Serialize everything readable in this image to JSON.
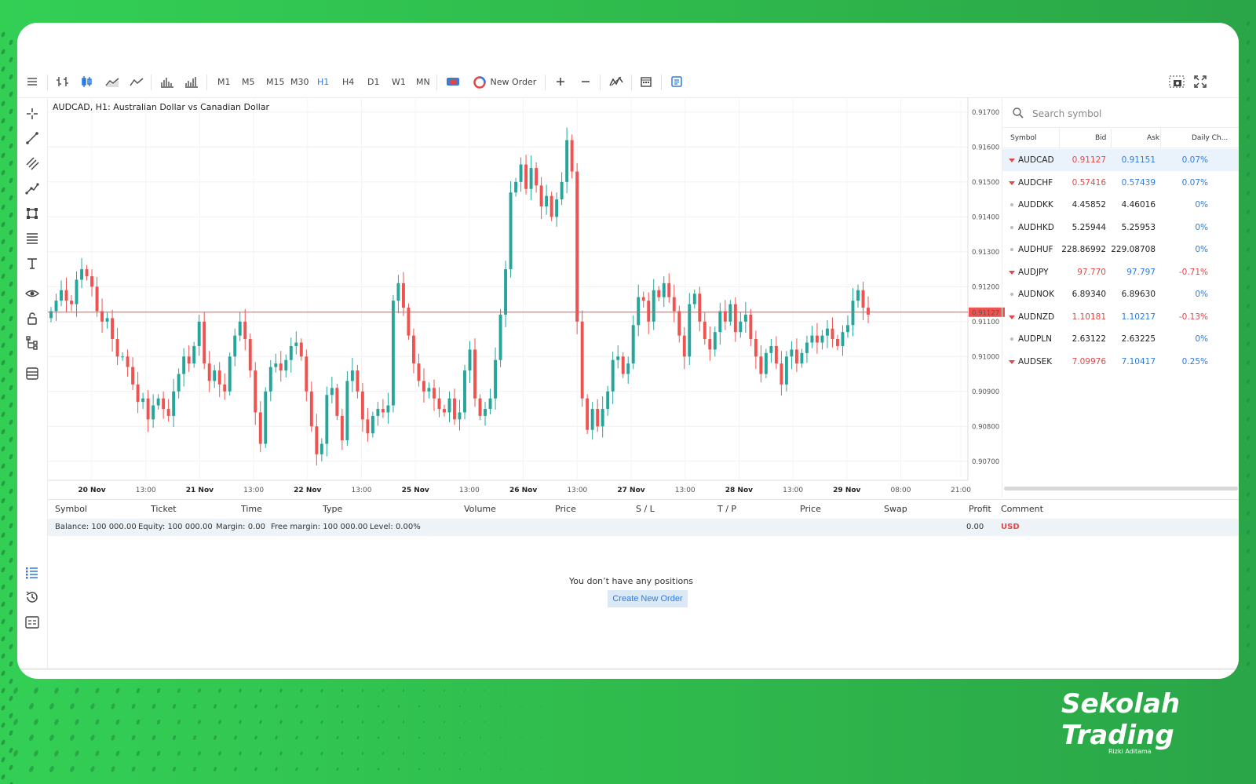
{
  "colors": {
    "bull": "#26a69a",
    "bear": "#ef5350",
    "accent": "#2e7be0",
    "frame": "#33cf55"
  },
  "toolbar": {
    "timeframes": [
      "M1",
      "M5",
      "M15",
      "M30",
      "H1",
      "H4",
      "D1",
      "W1",
      "MN"
    ],
    "active_timeframe": "H1",
    "new_order_label": "New Order",
    "icons": [
      "menu-icon",
      "bar-chart-icon",
      "candlestick-icon",
      "line-chart-icon",
      "line-icon",
      "volume-icon",
      "tick-volume-icon",
      "one-click-trading-icon",
      "zoom-in-icon",
      "zoom-out-icon",
      "indicators-icon",
      "calendar-icon",
      "depth-of-market-icon",
      "screenshot-icon",
      "fullscreen-icon"
    ]
  },
  "chart": {
    "title": "AUDCAD, H1: Australian Dollar vs Canadian Dollar",
    "current_price": "0.91127",
    "price_ticks": [
      "0.91700",
      "0.91600",
      "0.91500",
      "0.91400",
      "0.91300",
      "0.91200",
      "0.91100",
      "0.91000",
      "0.90900",
      "0.90800",
      "0.90700"
    ],
    "time_ticks": [
      {
        "label": "20 Nov",
        "bold": true
      },
      {
        "label": "13:00",
        "bold": false
      },
      {
        "label": "21 Nov",
        "bold": true
      },
      {
        "label": "13:00",
        "bold": false
      },
      {
        "label": "22 Nov",
        "bold": true
      },
      {
        "label": "13:00",
        "bold": false
      },
      {
        "label": "25 Nov",
        "bold": true
      },
      {
        "label": "13:00",
        "bold": false
      },
      {
        "label": "26 Nov",
        "bold": true
      },
      {
        "label": "13:00",
        "bold": false
      },
      {
        "label": "27 Nov",
        "bold": true
      },
      {
        "label": "13:00",
        "bold": false
      },
      {
        "label": "28 Nov",
        "bold": true
      },
      {
        "label": "13:00",
        "bold": false
      },
      {
        "label": "29 Nov",
        "bold": true
      },
      {
        "label": "08:00",
        "bold": false
      },
      {
        "label": "21:00",
        "bold": false
      }
    ]
  },
  "chart_data": {
    "type": "candlestick",
    "title": "AUDCAD, H1: Australian Dollar vs Canadian Dollar",
    "ylim": [
      0.9065,
      0.9172
    ],
    "current_price": 0.91127,
    "x": [
      "20 Nov",
      "13:00",
      "21 Nov",
      "13:00",
      "22 Nov",
      "13:00",
      "25 Nov",
      "13:00",
      "26 Nov",
      "13:00",
      "27 Nov",
      "13:00",
      "28 Nov",
      "13:00",
      "29 Nov",
      "08:00",
      "21:00"
    ],
    "closes": [
      0.9113,
      0.9116,
      0.9119,
      0.9116,
      0.9115,
      0.9122,
      0.9125,
      0.9123,
      0.912,
      0.9113,
      0.911,
      0.9111,
      0.9105,
      0.91,
      0.91,
      0.9097,
      0.9092,
      0.9087,
      0.9088,
      0.9082,
      0.9086,
      0.9088,
      0.9085,
      0.9083,
      0.909,
      0.9095,
      0.91,
      0.9098,
      0.9103,
      0.911,
      0.9098,
      0.9093,
      0.9096,
      0.9092,
      0.909,
      0.91,
      0.9106,
      0.911,
      0.9105,
      0.9096,
      0.9084,
      0.9075,
      0.909,
      0.9097,
      0.9098,
      0.9096,
      0.9099,
      0.9103,
      0.9104,
      0.91,
      0.909,
      0.908,
      0.9072,
      0.9075,
      0.9089,
      0.9091,
      0.9083,
      0.9076,
      0.9093,
      0.9096,
      0.909,
      0.9082,
      0.9078,
      0.9083,
      0.9085,
      0.9084,
      0.9086,
      0.9116,
      0.9121,
      0.9114,
      0.9106,
      0.9098,
      0.9093,
      0.909,
      0.9091,
      0.9088,
      0.9085,
      0.9084,
      0.9088,
      0.9082,
      0.9084,
      0.9096,
      0.9102,
      0.9088,
      0.9083,
      0.9085,
      0.9088,
      0.9099,
      0.9112,
      0.9125,
      0.9147,
      0.915,
      0.9155,
      0.9148,
      0.9154,
      0.9149,
      0.9143,
      0.9146,
      0.914,
      0.9145,
      0.915,
      0.9162,
      0.9153,
      0.911,
      0.9088,
      0.9079,
      0.9085,
      0.908,
      0.9085,
      0.909,
      0.9099,
      0.91,
      0.9095,
      0.9098,
      0.9109,
      0.9117,
      0.9116,
      0.911,
      0.9119,
      0.9117,
      0.9121,
      0.9117,
      0.9113,
      0.9106,
      0.91,
      0.9115,
      0.9118,
      0.911,
      0.9105,
      0.9102,
      0.9107,
      0.9113,
      0.911,
      0.9115,
      0.9107,
      0.911,
      0.9112,
      0.9105,
      0.91,
      0.9095,
      0.9101,
      0.9103,
      0.9098,
      0.9092,
      0.91,
      0.9102,
      0.9098,
      0.9101,
      0.9104,
      0.9106,
      0.9104,
      0.9106,
      0.9108,
      0.9105,
      0.9103,
      0.9107,
      0.9109,
      0.9116,
      0.9119,
      0.9114,
      0.9112
    ]
  },
  "symbols": {
    "search_placeholder": "Search symbol",
    "headers": {
      "symbol": "Symbol",
      "bid": "Bid",
      "ask": "Ask",
      "daily_change": "Daily Ch..."
    },
    "rows": [
      {
        "symbol": "AUDCAD",
        "bid": "0.91127",
        "ask": "0.91151",
        "change": "0.07%",
        "dir": "down",
        "selected": true
      },
      {
        "symbol": "AUDCHF",
        "bid": "0.57416",
        "ask": "0.57439",
        "change": "0.07%",
        "dir": "down",
        "selected": false
      },
      {
        "symbol": "AUDDKK",
        "bid": "4.45852",
        "ask": "4.46016",
        "change": "0%",
        "dir": "none",
        "selected": false
      },
      {
        "symbol": "AUDHKD",
        "bid": "5.25944",
        "ask": "5.25953",
        "change": "0%",
        "dir": "none",
        "selected": false
      },
      {
        "symbol": "AUDHUF",
        "bid": "228.86992",
        "ask": "229.08708",
        "change": "0%",
        "dir": "none",
        "selected": false
      },
      {
        "symbol": "AUDJPY",
        "bid": "97.770",
        "ask": "97.797",
        "change": "-0.71%",
        "dir": "down",
        "selected": false
      },
      {
        "symbol": "AUDNOK",
        "bid": "6.89340",
        "ask": "6.89630",
        "change": "0%",
        "dir": "none",
        "selected": false
      },
      {
        "symbol": "AUDNZD",
        "bid": "1.10181",
        "ask": "1.10217",
        "change": "-0.13%",
        "dir": "down",
        "selected": false
      },
      {
        "symbol": "AUDPLN",
        "bid": "2.63122",
        "ask": "2.63225",
        "change": "0%",
        "dir": "none",
        "selected": false
      },
      {
        "symbol": "AUDSEK",
        "bid": "7.09976",
        "ask": "7.10417",
        "change": "0.25%",
        "dir": "down",
        "selected": false
      }
    ]
  },
  "terminal": {
    "headers": {
      "symbol": "Symbol",
      "ticket": "Ticket",
      "time": "Time",
      "type": "Type",
      "volume": "Volume",
      "price": "Price",
      "sl": "S / L",
      "tp": "T / P",
      "price2": "Price",
      "swap": "Swap",
      "profit": "Profit",
      "comment": "Comment"
    },
    "balance": "Balance: 100 000.00",
    "equity": "Equity: 100 000.00",
    "margin": "Margin: 0.00",
    "free_margin": "Free margin: 100 000.00",
    "level": "Level: 0.00%",
    "profit": "0.00",
    "currency": "USD",
    "empty_message": "You don’t have any positions",
    "create_order_label": "Create New Order"
  },
  "brand": {
    "line1": "Sekolah",
    "line2": "Trading",
    "sub": "Rizki Aditama"
  }
}
